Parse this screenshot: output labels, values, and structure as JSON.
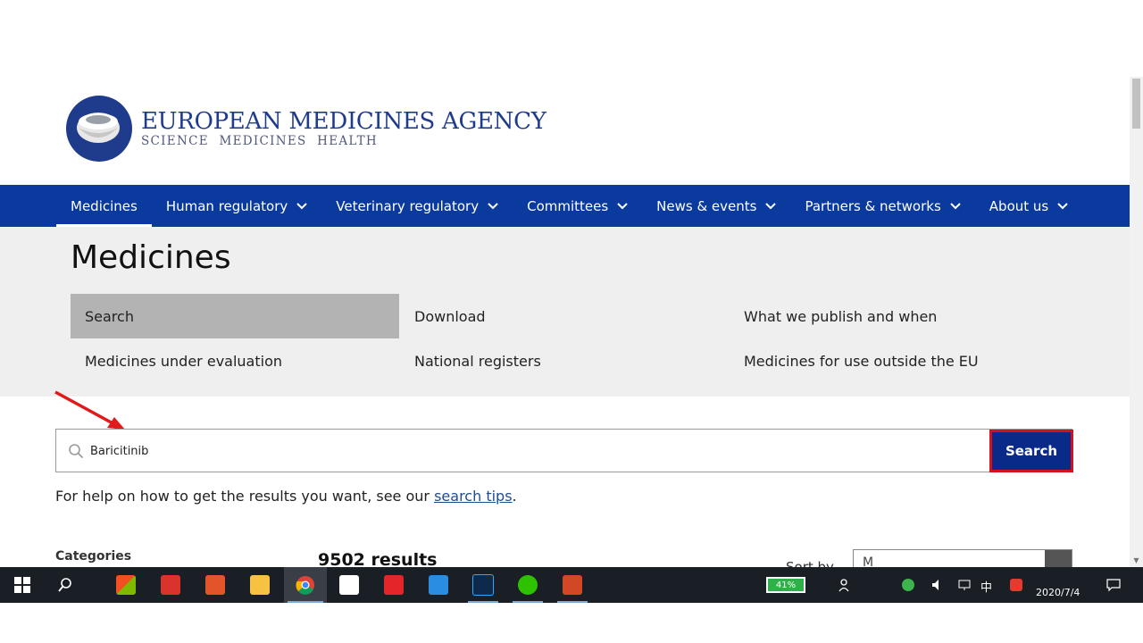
{
  "logo": {
    "name": "EUROPEAN MEDICINES AGENCY",
    "tagline": "SCIENCE  MEDICINES  HEALTH"
  },
  "nav": {
    "items": [
      {
        "label": "Medicines",
        "dropdown": false,
        "active": true
      },
      {
        "label": "Human regulatory",
        "dropdown": true
      },
      {
        "label": "Veterinary regulatory",
        "dropdown": true
      },
      {
        "label": "Committees",
        "dropdown": true
      },
      {
        "label": "News & events",
        "dropdown": true
      },
      {
        "label": "Partners & networks",
        "dropdown": true
      },
      {
        "label": "About us",
        "dropdown": true
      }
    ]
  },
  "page": {
    "title": "Medicines",
    "subnav": [
      {
        "label": "Search",
        "selected": true
      },
      {
        "label": "Download"
      },
      {
        "label": "What we publish and when"
      },
      {
        "label": "Medicines under evaluation"
      },
      {
        "label": "National registers"
      },
      {
        "label": "Medicines for use outside the EU"
      }
    ]
  },
  "search": {
    "value": "Baricitinib",
    "button_label": "Search",
    "help_prefix": "For help on how to get the results you want, see our ",
    "help_link": "search tips",
    "help_suffix": "."
  },
  "results": {
    "categories_label": "Categories",
    "count_text": "9502 results",
    "sort_label": "Sort by",
    "sort_value": "M"
  },
  "taskbar": {
    "battery": "41%",
    "ime": "中",
    "date": "2020/7/4"
  },
  "colors": {
    "nav_bg": "#0a3a9e",
    "button_bg": "#0a2a8a",
    "highlight_red": "#d3121f",
    "subnav_selected": "#b3b3b3"
  }
}
